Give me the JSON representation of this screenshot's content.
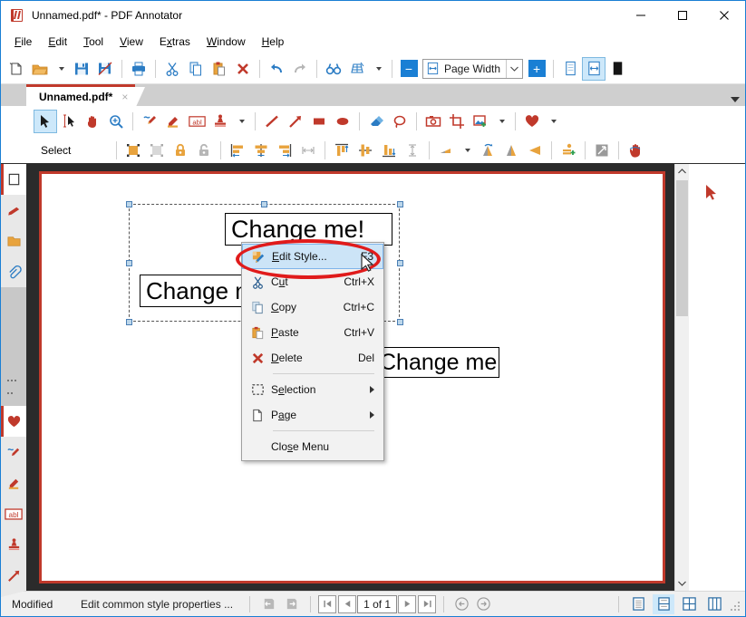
{
  "window": {
    "title": "Unnamed.pdf* - PDF Annotator",
    "app_icon": "pdf-annotator-icon",
    "minimize_label": "—",
    "maximize_label": "☐",
    "close_label": "✕"
  },
  "menubar": {
    "items": [
      {
        "label": "File",
        "accel": "F"
      },
      {
        "label": "Edit",
        "accel": "E"
      },
      {
        "label": "Tool",
        "accel": "T"
      },
      {
        "label": "View",
        "accel": "V"
      },
      {
        "label": "Extras",
        "accel": "x"
      },
      {
        "label": "Window",
        "accel": "W"
      },
      {
        "label": "Help",
        "accel": "H"
      }
    ]
  },
  "main_toolbar": {
    "buttons": [
      {
        "name": "new-document-icon",
        "title": "New"
      },
      {
        "name": "open-document-icon",
        "title": "Open"
      },
      {
        "name": "open-dropdown-caret-icon",
        "title": "Open options"
      },
      {
        "name": "save-icon",
        "title": "Save"
      },
      {
        "name": "save-as-icon",
        "title": "Save As"
      },
      {
        "name": "print-icon",
        "title": "Print"
      },
      {
        "name": "cut-icon",
        "title": "Cut"
      },
      {
        "name": "copy-icon",
        "title": "Copy"
      },
      {
        "name": "paste-icon",
        "title": "Paste"
      },
      {
        "name": "delete-icon",
        "title": "Delete"
      },
      {
        "name": "undo-icon",
        "title": "Undo"
      },
      {
        "name": "redo-icon",
        "title": "Redo"
      },
      {
        "name": "find-icon",
        "title": "Find"
      },
      {
        "name": "ocr-icon",
        "title": "Recognize Text"
      },
      {
        "name": "ocr-dropdown-caret-icon",
        "title": "Recognize options"
      }
    ],
    "zoom": {
      "minus_label": "−",
      "plus_label": "+",
      "value": "Page Width",
      "icon": "page-width-icon",
      "dropdown_icon": "chevron-down-icon"
    },
    "view_modes": [
      {
        "name": "fit-page-icon",
        "active": false
      },
      {
        "name": "fit-width-icon",
        "active": true
      },
      {
        "name": "full-screen-icon",
        "active": false
      }
    ]
  },
  "tabbar": {
    "tab_label": "Unnamed.pdf*",
    "close_label": "×",
    "overflow_icon": "chevron-down-icon"
  },
  "annotation_toolbar": {
    "row1": [
      {
        "name": "select-tool-icon",
        "active": true
      },
      {
        "name": "select-text-tool-icon",
        "active": false
      },
      {
        "name": "pan-hand-tool-icon",
        "active": false
      },
      {
        "name": "zoom-tool-icon",
        "active": false
      },
      {
        "name": "pen-tool-icon",
        "active": false
      },
      {
        "name": "highlighter-tool-icon",
        "active": false
      },
      {
        "name": "text-tool-icon",
        "active": false
      },
      {
        "name": "stamp-tool-icon",
        "active": false
      },
      {
        "name": "stamp-dropdown-caret-icon",
        "active": false
      },
      {
        "name": "line-tool-icon",
        "active": false
      },
      {
        "name": "arrow-tool-icon",
        "active": false
      },
      {
        "name": "rectangle-tool-icon",
        "active": false
      },
      {
        "name": "ellipse-tool-icon",
        "active": false
      },
      {
        "name": "eraser-tool-icon",
        "active": false
      },
      {
        "name": "lasso-tool-icon",
        "active": false
      },
      {
        "name": "snapshot-tool-icon",
        "active": false
      },
      {
        "name": "crop-tool-icon",
        "active": false
      },
      {
        "name": "insert-image-icon",
        "active": false
      },
      {
        "name": "insert-image-dropdown-caret-icon",
        "active": false
      },
      {
        "name": "favorites-heart-icon",
        "active": false
      },
      {
        "name": "favorites-dropdown-caret-icon",
        "active": false
      }
    ],
    "row2_label": "Select",
    "row2": [
      {
        "name": "group-icon"
      },
      {
        "name": "ungroup-icon"
      },
      {
        "name": "lock-icon"
      },
      {
        "name": "unlock-icon"
      },
      {
        "name": "align-left-icon"
      },
      {
        "name": "align-center-horizontal-icon"
      },
      {
        "name": "align-right-icon"
      },
      {
        "name": "distribute-horizontal-icon"
      },
      {
        "name": "align-top-icon"
      },
      {
        "name": "align-middle-vertical-icon"
      },
      {
        "name": "align-bottom-icon"
      },
      {
        "name": "distribute-vertical-icon"
      },
      {
        "name": "rotate-icon"
      },
      {
        "name": "rotate-dropdown-caret-icon"
      },
      {
        "name": "rotate-free-icon"
      },
      {
        "name": "flip-vertical-icon"
      },
      {
        "name": "flip-horizontal-icon"
      },
      {
        "name": "bring-to-front-icon"
      },
      {
        "name": "resize-icon"
      },
      {
        "name": "pan-hand-red-icon"
      }
    ]
  },
  "left_rail": {
    "items": [
      {
        "name": "sidebar-tab-pages",
        "icon": "page-thumbnail-icon",
        "active": true
      },
      {
        "name": "sidebar-tab-bookmarks",
        "icon": "bookmark-icon",
        "active": false
      },
      {
        "name": "sidebar-tab-folders",
        "icon": "folder-icon",
        "active": false
      },
      {
        "name": "sidebar-tab-attachments",
        "icon": "paperclip-icon",
        "active": false
      }
    ],
    "tools": [
      {
        "name": "sidebar-tool-favorites",
        "icon": "heart-icon",
        "active": true
      },
      {
        "name": "sidebar-tool-pen",
        "icon": "pen-icon",
        "active": false
      },
      {
        "name": "sidebar-tool-highlighter",
        "icon": "highlighter-icon",
        "active": false
      },
      {
        "name": "sidebar-tool-text",
        "icon": "abl-text-icon",
        "active": false
      },
      {
        "name": "sidebar-tool-stamp",
        "icon": "stamp-icon",
        "active": false
      },
      {
        "name": "sidebar-tool-arrow",
        "icon": "arrow-icon",
        "active": false
      }
    ]
  },
  "document": {
    "text_boxes": [
      {
        "name": "text-annotation-1",
        "text": "Change me!"
      },
      {
        "name": "text-annotation-2",
        "text": "Change me!"
      },
      {
        "name": "text-annotation-3",
        "text": "Change me!"
      }
    ],
    "selection": {
      "name": "selection-marquee",
      "handles": 8
    },
    "hand_tool_overlay": {
      "name": "pan-hand-overlay-icon"
    }
  },
  "context_menu": {
    "items": [
      {
        "name": "menu-edit-style",
        "label": "Edit Style...",
        "accel": "E",
        "shortcut": "F3",
        "icon": "edit-style-icon",
        "selected": true,
        "submenu": false
      },
      {
        "name": "menu-cut",
        "label": "Cut",
        "accel": "u",
        "shortcut": "Ctrl+X",
        "icon": "cut-icon",
        "selected": false,
        "submenu": false
      },
      {
        "name": "menu-copy",
        "label": "Copy",
        "accel": "C",
        "shortcut": "Ctrl+C",
        "icon": "copy-icon",
        "selected": false,
        "submenu": false
      },
      {
        "name": "menu-paste",
        "label": "Paste",
        "accel": "P",
        "shortcut": "Ctrl+V",
        "icon": "paste-icon",
        "selected": false,
        "submenu": false
      },
      {
        "name": "menu-delete",
        "label": "Delete",
        "accel": "D",
        "shortcut": "Del",
        "icon": "delete-x-icon",
        "selected": false,
        "submenu": false
      },
      {
        "name": "menu-selection",
        "label": "Selection",
        "accel": "e",
        "shortcut": "",
        "icon": "selection-icon",
        "selected": false,
        "submenu": true
      },
      {
        "name": "menu-page",
        "label": "Page",
        "accel": "a",
        "shortcut": "",
        "icon": "page-icon",
        "selected": false,
        "submenu": true
      },
      {
        "name": "menu-close",
        "label": "Close Menu",
        "accel": "s",
        "shortcut": "",
        "icon": "",
        "selected": false,
        "submenu": false
      }
    ],
    "highlight_annotation": {
      "name": "red-ellipse-annotation",
      "color": "#e01b1b"
    }
  },
  "right_pane": {
    "cursor_icon": "mouse-cursor-icon"
  },
  "statusbar": {
    "modified_label": "Modified",
    "message": "Edit common style properties ...",
    "nav_prev_icon": "history-back-icon",
    "nav_next_icon": "history-forward-icon",
    "first_page_icon": "first-page-icon",
    "prev_page_icon": "prev-page-icon",
    "page_indicator": "1 of 1",
    "next_page_icon": "next-page-icon",
    "last_page_icon": "last-page-icon",
    "back_icon": "back-circle-icon",
    "forward_icon": "forward-circle-icon",
    "view_buttons": [
      {
        "name": "view-single-page",
        "active": false
      },
      {
        "name": "view-continuous",
        "active": true
      },
      {
        "name": "view-facing",
        "active": false
      },
      {
        "name": "view-grid",
        "active": false
      }
    ]
  },
  "colors": {
    "accent_red": "#c0392b",
    "accent_blue": "#1a7fd4",
    "highlight_blue": "#cde8fa",
    "annotation_red": "#e01b1b"
  }
}
